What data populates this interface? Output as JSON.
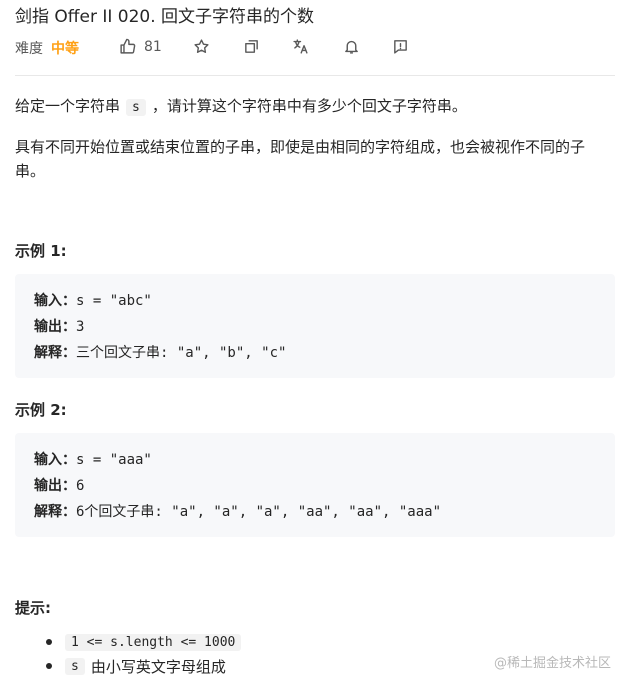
{
  "title": "剑指 Offer II 020. 回文子字符串的个数",
  "meta": {
    "difficulty_label": "难度",
    "difficulty": "中等",
    "likes": "81"
  },
  "icons": [
    "thumbs-up-icon",
    "star-icon",
    "share-icon",
    "translate-icon",
    "bell-icon",
    "feedback-icon"
  ],
  "description": {
    "p1_before": "给定一个字符串",
    "p1_code": "s",
    "p1_after": "，请计算这个字符串中有多少个回文子字符串。",
    "p2": "具有不同开始位置或结束位置的子串，即使是由相同的字符组成，也会被视作不同的子串。"
  },
  "examples": [
    {
      "heading": "示例 1:",
      "input_label": "输入：",
      "input": "s = \"abc\"",
      "output_label": "输出：",
      "output": "3",
      "explain_label": "解释：",
      "explain": "三个回文子串: \"a\", \"b\", \"c\""
    },
    {
      "heading": "示例 2:",
      "input_label": "输入：",
      "input": "s = \"aaa\"",
      "output_label": "输出：",
      "output": "6",
      "explain_label": "解释：",
      "explain": "6个回文子串: \"a\", \"a\", \"a\", \"aa\", \"aa\", \"aaa\""
    }
  ],
  "hints": {
    "heading": "提示:",
    "items": [
      {
        "code": "1 <= s.length <= 1000",
        "text": ""
      },
      {
        "code": "s",
        "text": "由小写英文字母组成"
      }
    ]
  },
  "watermark": "@稀土掘金技术社区",
  "colors": {
    "accent_difficulty": "#ffa116",
    "code_bg": "#f7f8fa",
    "text": "#262626"
  }
}
